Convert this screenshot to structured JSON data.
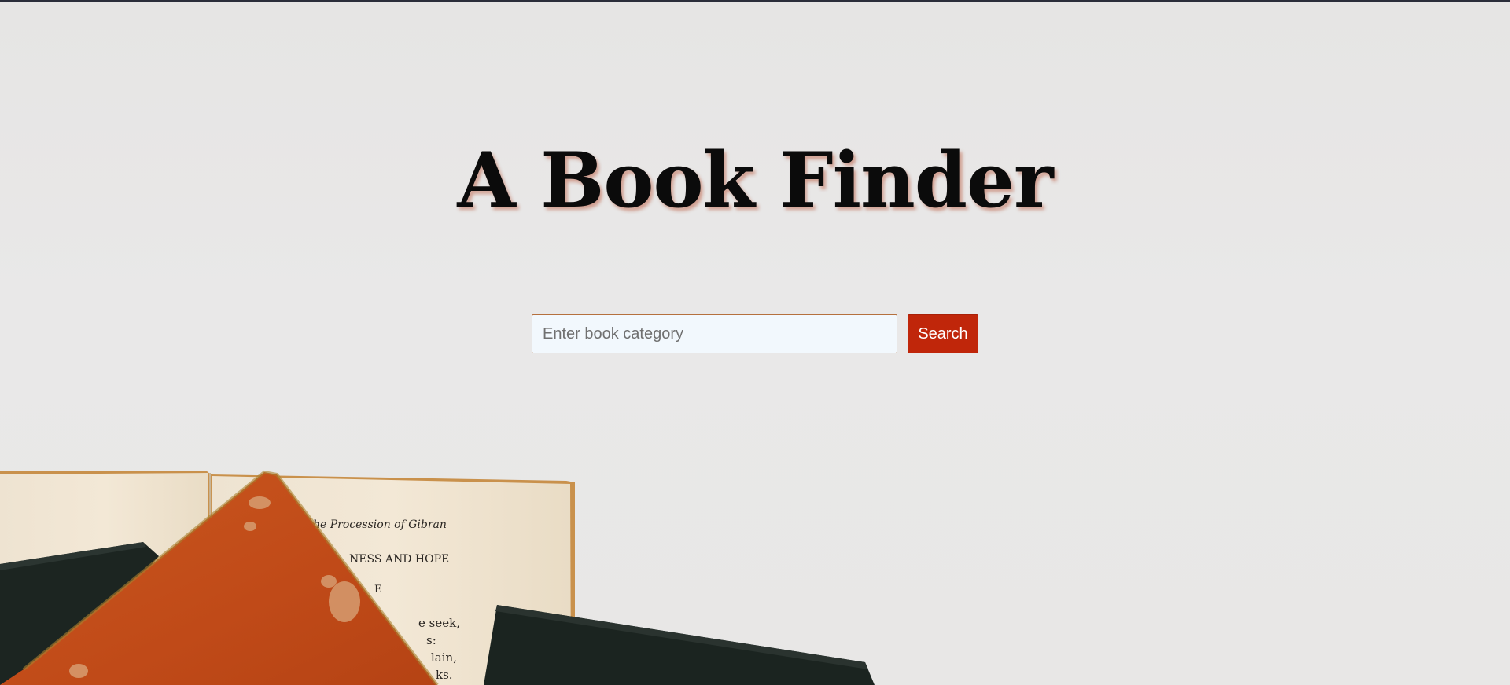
{
  "hero": {
    "title": "A Book Finder"
  },
  "search": {
    "placeholder": "Enter book category",
    "value": "",
    "button_label": "Search"
  },
  "photo": {
    "page_lines": [
      "he Procession of Gibran",
      "NESS AND HOPE",
      "E",
      "e seek,",
      "s:",
      "lain,",
      "ks."
    ]
  },
  "colors": {
    "background": "#e8e7e6",
    "title_text": "#0b0b0b",
    "title_shadow": "#b4462880",
    "input_background": "#f2f8fd",
    "input_border": "#b5703e",
    "button_background": "#c0260a",
    "button_text": "#ffffff",
    "book_orange": "#c24e1c",
    "book_dark": "#1b2420",
    "page_cream": "#f1e4cf"
  }
}
